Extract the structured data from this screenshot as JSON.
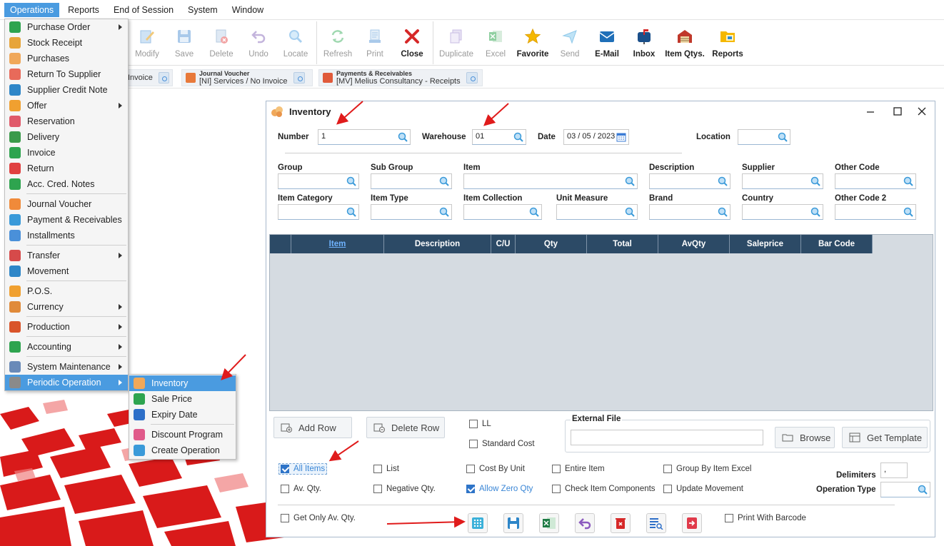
{
  "menubar": {
    "items": [
      "Operations",
      "Reports",
      "End of Session",
      "System",
      "Window"
    ]
  },
  "toolbar": {
    "buttons": [
      {
        "label": "Modify",
        "icon": "modify-icon"
      },
      {
        "label": "Save",
        "icon": "save-icon"
      },
      {
        "label": "Delete",
        "icon": "delete-icon"
      },
      {
        "label": "Undo",
        "icon": "undo-icon"
      },
      {
        "label": "Locate",
        "icon": "locate-icon"
      },
      {
        "label": "Refresh",
        "icon": "refresh-icon"
      },
      {
        "label": "Print",
        "icon": "print-icon"
      },
      {
        "label": "Close",
        "icon": "close-icon"
      },
      {
        "label": "Duplicate",
        "icon": "duplicate-icon"
      },
      {
        "label": "Excel",
        "icon": "excel-icon"
      },
      {
        "label": "Favorite",
        "icon": "star-icon"
      },
      {
        "label": "Send",
        "icon": "send-icon"
      },
      {
        "label": "E-Mail",
        "icon": "email-icon"
      },
      {
        "label": "Inbox",
        "icon": "inbox-icon"
      },
      {
        "label": "Item Qtys.",
        "icon": "warehouse-icon"
      },
      {
        "label": "Reports",
        "icon": "folder-icon"
      }
    ]
  },
  "quickbar": {
    "items": [
      {
        "title": "",
        "sub": "Invoice"
      },
      {
        "title": "Journal Voucher",
        "sub": "[NI] Services / No Invoice"
      },
      {
        "title": "Payments & Receivables",
        "sub": "[MV] Melius Consultancy - Receipts"
      }
    ]
  },
  "ops_menu": {
    "items": [
      {
        "label": "Purchase Order",
        "submenu": true
      },
      {
        "label": "Stock Receipt"
      },
      {
        "label": "Purchases"
      },
      {
        "label": "Return To Supplier"
      },
      {
        "label": "Supplier Credit Note"
      },
      {
        "label": "Offer",
        "submenu": true
      },
      {
        "label": "Reservation"
      },
      {
        "label": "Delivery"
      },
      {
        "label": "Invoice"
      },
      {
        "label": "Return"
      },
      {
        "label": "Acc. Cred. Notes"
      },
      {
        "label": "Journal Voucher"
      },
      {
        "label": "Payment & Receivables"
      },
      {
        "label": "Installments"
      },
      {
        "label": "Transfer",
        "submenu": true
      },
      {
        "label": "Movement"
      },
      {
        "label": "P.O.S."
      },
      {
        "label": "Currency",
        "submenu": true
      },
      {
        "label": "Production",
        "submenu": true
      },
      {
        "label": "Accounting",
        "submenu": true
      },
      {
        "label": "System Maintenance",
        "submenu": true
      },
      {
        "label": "Periodic Operation",
        "submenu": true
      }
    ]
  },
  "sub_menu": {
    "items": [
      {
        "label": "Inventory"
      },
      {
        "label": "Sale Price"
      },
      {
        "label": "Expiry Date"
      },
      {
        "label": "Discount Program"
      },
      {
        "label": "Create Operation"
      }
    ]
  },
  "inventory": {
    "title": "Inventory",
    "number_label": "Number",
    "number_value": "1",
    "warehouse_label": "Warehouse",
    "warehouse_value": "01",
    "date_label": "Date",
    "date_value": "03 / 05 / 2023",
    "location_label": "Location",
    "filters_row1": [
      "Group",
      "Sub Group",
      "Item",
      "Description",
      "Supplier",
      "Other Code"
    ],
    "filters_row2": [
      "Item Category",
      "Item Type",
      "Item Collection",
      "Unit Measure",
      "Brand",
      "Country",
      "Other Code 2"
    ],
    "grid_columns": [
      "",
      "Item",
      "Description",
      "C/U",
      "Qty",
      "Total",
      "AvQty",
      "Saleprice",
      "Bar Code"
    ],
    "add_row": "Add Row",
    "delete_row": "Delete Row",
    "ll": "LL",
    "standard_cost": "Standard Cost",
    "external_file": "External File",
    "browse": "Browse",
    "get_template": "Get Template",
    "options_row1": [
      "All Items",
      "List",
      "Cost By Unit",
      "Entire Item",
      "Group By Item Excel"
    ],
    "options_row2": [
      "Av. Qty.",
      "Negative Qty.",
      "Allow Zero Qty",
      "Check Item Components",
      "Update Movement"
    ],
    "get_only_av_qty": "Get Only Av. Qty.",
    "print_with_barcode": "Print With Barcode",
    "delimiters_label": "Delimiters",
    "delimiters_value": ",",
    "operation_type_label": "Operation Type"
  },
  "colors": {
    "accent": "#4a9be0",
    "grid_header": "#2c4a66",
    "grid_body": "#d5dbe1",
    "close_red": "#d62828"
  }
}
